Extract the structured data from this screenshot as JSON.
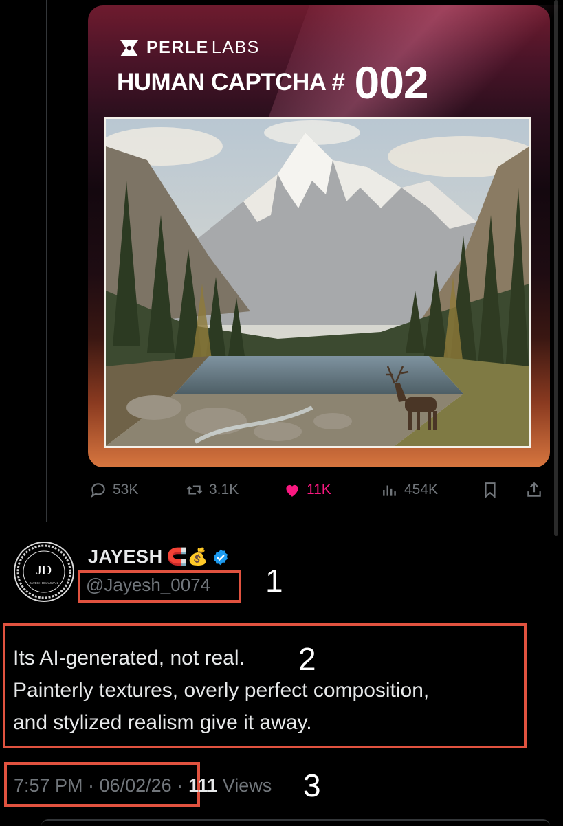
{
  "card": {
    "brand_bold": "PERLE",
    "brand_light": "LABS",
    "title": "HUMAN CAPTCHA #",
    "number": "002"
  },
  "actions": {
    "replies": "53K",
    "reposts": "3.1K",
    "likes": "11K",
    "views": "454K"
  },
  "reply": {
    "name": "JAYESH",
    "emojis": "🧲💰",
    "handle": "@Jayesh_0074",
    "avatar_initials": "JD",
    "avatar_caption": "JAYESH DHANWANI",
    "text_lines": [
      "Its AI-generated, not real.",
      "Painterly textures, overly perfect composition,",
      "and stylized realism give it away."
    ],
    "time": "7:57 PM · 06/02/26 ·",
    "views_count": "111",
    "views_label": "Views"
  },
  "annotations": [
    "1",
    "2",
    "3"
  ],
  "colors": {
    "accent_like": "#f91880",
    "verified_blue": "#1d9bf0",
    "annotation_box": "#e0523f",
    "muted_text": "#71767b"
  }
}
